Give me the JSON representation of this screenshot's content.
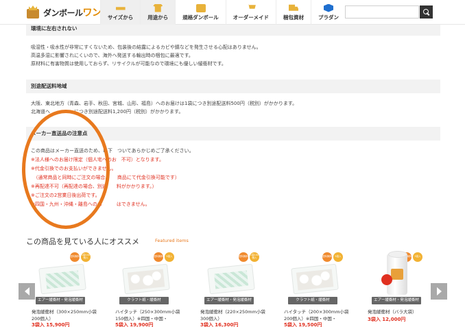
{
  "header": {
    "logo_text": "ダンボール",
    "logo_text_accent": "ワン",
    "nav": [
      {
        "label": "サイズから",
        "icon": "ruler-icon"
      },
      {
        "label": "用途から",
        "icon": "tshirt-icon"
      },
      {
        "label": "規格ダンボール",
        "icon": "box-icon"
      },
      {
        "label": "オーダーメイド",
        "icon": "cart-icon"
      },
      {
        "label": "梱包資材",
        "icon": "truck-icon"
      },
      {
        "label": "プラダン",
        "icon": "cube-icon"
      }
    ],
    "search_placeholder": ""
  },
  "sections": {
    "env": {
      "title": "環境に左右されない",
      "lines": [
        "吸湿性・吸水性が非常にすくないため、包装後の結露によるカビや錆などを発生させる心配はありません。",
        "高温多湿に影響されにくいので、海外へ発送する輸出時の梱包に最適です。",
        "原材料に有害物質は使用しておらず、リサイクルが可能なので環境にも優しい緩衝材です。"
      ]
    },
    "shipping": {
      "title": "別途配送料地域",
      "lines": [
        "大阪、東北地方（青森、岩手、秋田、宮城、山形、福島）へのお届けは1袋につき別途配送料500円（税別）がかかります。",
        "北海道へ　　　　　につき別途配送料1,200円（税別）がかかります。"
      ]
    },
    "maker": {
      "title": "メーカー直送品の注意点",
      "intro": "この商品はメーカー直送のため、以下　ついてあらかじめご了承ください。",
      "notes": [
        "※法人様へのお届け限定（個人宅へのお　不可）となります。",
        "※代金引換でのお支払いができません。",
        "　（通常商品と同時にご注文の場合、　　商品にて代金引換可能です）",
        "※再配達不可（再配達の場合、別途　　料がかかります。）",
        "※ご注文の2営業日後出荷です。",
        "※四国・九州・沖縄・離島へのお　　　はできません。"
      ]
    }
  },
  "recommend": {
    "title": "この商品を見ている人にオススメ",
    "subtitle": "Featured items",
    "products": [
      {
        "category": "エアー緩衝材・発泡緩衝材",
        "name": "発泡緩衝材（300×250mm小袋200個入）",
        "price": "3袋入 15,900円",
        "badges": [
          "送料無料",
          "1袋100個入"
        ]
      },
      {
        "category": "クラフト紙・緩衝材",
        "name": "ハイタッチ（250×300mm小袋150個入）※四国・中国・",
        "price": "5袋入 19,900円",
        "badges": [
          "送料無料",
          "5袋入"
        ]
      },
      {
        "category": "エアー緩衝材・発泡緩衝材",
        "name": "発泡緩衝材（220×250mm小袋300個入）",
        "price": "3袋入 16,300円",
        "badges": [
          "送料無料",
          "1袋100個入"
        ]
      },
      {
        "category": "クラフト紙・緩衝材",
        "name": "ハイタッチ（200×300mm小袋200個入）※四国・中国・",
        "price": "5袋入 19,500円",
        "badges": [
          "送料無料",
          "5袋入"
        ]
      },
      {
        "category": "エアー緩衝材・発泡緩衝材",
        "name": "発泡緩衝材（バラ大袋）",
        "price": "3袋入 12,000円",
        "badges": [
          "送料無料",
          "3袋入"
        ]
      }
    ]
  }
}
